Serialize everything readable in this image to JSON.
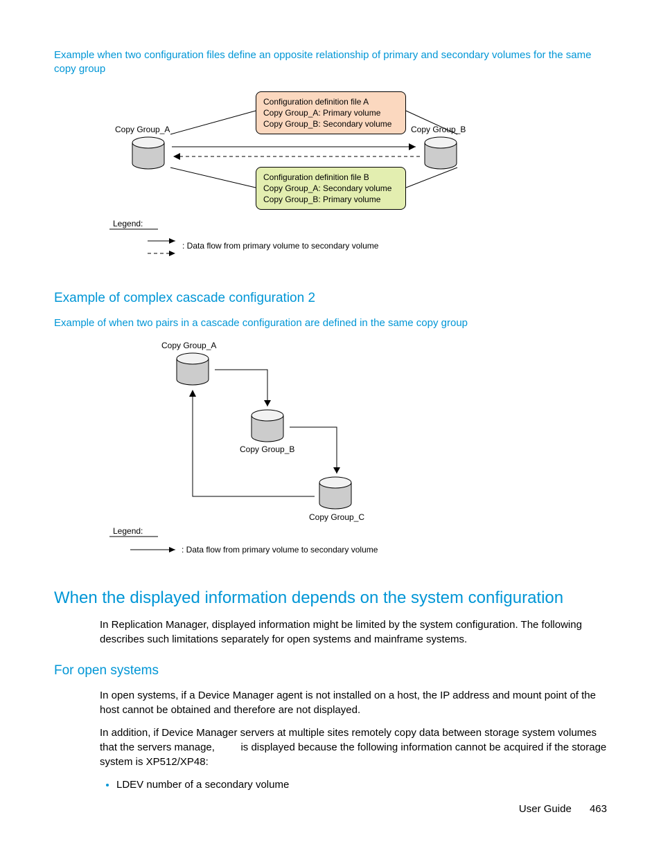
{
  "intro_link": "Example when two configuration files define an opposite relationship of primary and secondary volumes for the same copy group",
  "diagram1": {
    "group_a": "Copy Group_A",
    "group_b": "Copy Group_B",
    "file_a_title": "Configuration definition file A",
    "file_a_l1": "Copy Group_A: Primary volume",
    "file_a_l2": "Copy Group_B: Secondary volume",
    "file_b_title": "Configuration definition file B",
    "file_b_l1": "Copy Group_A: Secondary volume",
    "file_b_l2": "Copy Group_B: Primary volume",
    "legend": "Legend:",
    "legend_text": ": Data flow from primary volume to secondary volume"
  },
  "heading_cascade": "Example of complex cascade configuration 2",
  "cascade_link": "Example of when two pairs in a cascade configuration are defined in the same copy group",
  "diagram2": {
    "group_a": "Copy Group_A",
    "group_b": "Copy Group_B",
    "group_c": "Copy Group_C",
    "legend": "Legend:",
    "legend_text": ": Data flow from primary volume to secondary volume"
  },
  "heading_depends": "When the displayed information depends on the system configuration",
  "depends_para": "In Replication Manager, displayed information might be limited by the system configuration. The following describes such limitations separately for open systems and mainframe systems.",
  "heading_open": "For open systems",
  "open_p1": "In open systems, if a Device Manager agent is not installed on a host, the IP address and mount point of the host cannot be obtained and therefore are not displayed.",
  "open_p2_a": "In addition, if Device Manager servers at multiple sites remotely copy data between storage system volumes that the servers manage, ",
  "open_p2_b": " is displayed because the following information cannot be acquired if the storage system is XP512/XP48:",
  "bullet1": "LDEV number of a secondary volume",
  "footer_label": "User Guide",
  "footer_page": "463"
}
